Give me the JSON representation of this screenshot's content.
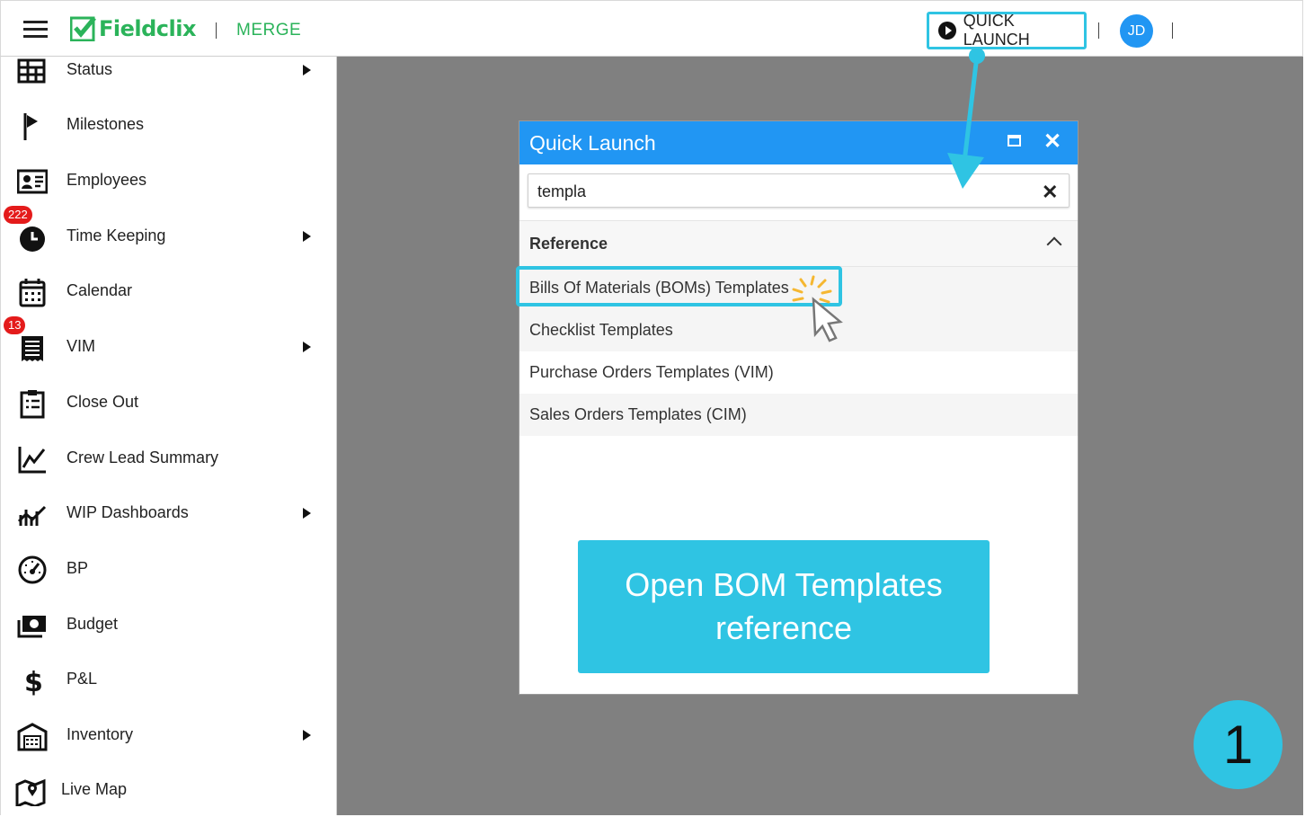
{
  "header": {
    "brand": "Fieldclix",
    "module": "MERGE",
    "quick_launch_label": "QUICK LAUNCH",
    "user_initials": "JD"
  },
  "sidebar": {
    "items": [
      {
        "label": "Status",
        "icon": "status-grid-icon",
        "submenu": true
      },
      {
        "label": "Milestones",
        "icon": "flag-icon",
        "submenu": false
      },
      {
        "label": "Employees",
        "icon": "id-card-icon",
        "submenu": false
      },
      {
        "label": "Time Keeping",
        "icon": "clock-icon",
        "submenu": true,
        "badge": "222"
      },
      {
        "label": "Calendar",
        "icon": "calendar-icon",
        "submenu": false
      },
      {
        "label": "VIM",
        "icon": "receipt-icon",
        "submenu": true,
        "badge": "13"
      },
      {
        "label": "Close Out",
        "icon": "clipboard-list-icon",
        "submenu": false
      },
      {
        "label": "Crew Lead Summary",
        "icon": "line-chart-icon",
        "submenu": false
      },
      {
        "label": "WIP Dashboards",
        "icon": "chart-trend-icon",
        "submenu": true
      },
      {
        "label": "BP",
        "icon": "gauge-icon",
        "submenu": false
      },
      {
        "label": "Budget",
        "icon": "money-icon",
        "submenu": false
      },
      {
        "label": "P&L",
        "icon": "dollar-icon",
        "submenu": false
      },
      {
        "label": "Inventory",
        "icon": "warehouse-icon",
        "submenu": true
      },
      {
        "label": "Live Map",
        "icon": "map-pin-icon",
        "submenu": false
      }
    ]
  },
  "quick_launch": {
    "title": "Quick Launch",
    "search_value": "templa",
    "section": "Reference",
    "results": [
      "Bills Of Materials (BOMs) Templates",
      "Checklist Templates",
      "Purchase Orders Templates (VIM)",
      "Sales Orders Templates (CIM)"
    ]
  },
  "callout": {
    "line1": "Open BOM Templates",
    "line2": "reference"
  },
  "step_number": "1",
  "colors": {
    "brand_green": "#2bb35a",
    "dialog_header": "#2196f3",
    "highlight": "#2fc4e3",
    "badge": "#e41b1b",
    "overlay": "#808080"
  }
}
